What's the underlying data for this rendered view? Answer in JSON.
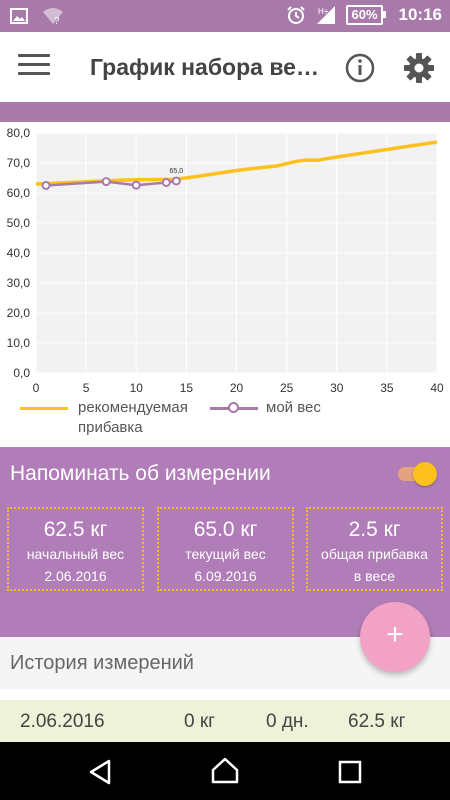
{
  "status_bar": {
    "battery": "60%",
    "time": "10:16",
    "icons": [
      "image-icon",
      "wifi-unknown-icon",
      "alarm-icon",
      "signal-icon",
      "battery-icon"
    ]
  },
  "app_bar": {
    "title": "График набора ве…",
    "icons": [
      "menu-icon",
      "info-icon",
      "settings-icon"
    ]
  },
  "chart_data": {
    "type": "line",
    "xlim": [
      0,
      40
    ],
    "ylim": [
      0,
      80
    ],
    "x_ticks": [
      "0",
      "5",
      "10",
      "15",
      "20",
      "25",
      "30",
      "35",
      "40"
    ],
    "y_ticks": [
      "0,0",
      "10,0",
      "20,0",
      "30,0",
      "40,0",
      "50,0",
      "60,0",
      "70,0",
      "80,0"
    ],
    "grid": true,
    "legend_position": "bottom",
    "series": [
      {
        "name": "рекомендуемая прибавка",
        "color": "#fcc11e",
        "x": [
          0,
          2,
          4,
          6,
          8,
          10,
          12,
          14,
          16,
          18,
          20,
          22,
          24,
          26,
          27,
          28,
          30,
          32,
          34,
          36,
          38,
          40
        ],
        "y": [
          63,
          63.3,
          63.6,
          63.9,
          64.2,
          64.4,
          64.5,
          64.6,
          65.5,
          66.5,
          67.5,
          68.3,
          69,
          70.6,
          71,
          70.9,
          72,
          73,
          74,
          75,
          76,
          77
        ]
      },
      {
        "name": "мой вес",
        "color": "#a77aa9",
        "x": [
          1,
          7,
          10,
          13,
          14
        ],
        "y": [
          62.5,
          63.8,
          62.6,
          63.5,
          64
        ]
      }
    ],
    "annotations": [
      {
        "text": "65,0"
      }
    ]
  },
  "reminder": {
    "label": "Напоминать об измерении",
    "enabled": true
  },
  "stats": [
    {
      "value": "62.5 кг",
      "label1": "начальный вес",
      "label2": "2.06.2016"
    },
    {
      "value": "65.0 кг",
      "label1": "текущий вес",
      "label2": "6.09.2016"
    },
    {
      "value": "2.5 кг",
      "label1": "общая прибавка",
      "label2": "в весе"
    }
  ],
  "history": {
    "title": "История измерений",
    "rows": [
      {
        "date": "2.06.2016",
        "gain": "0 кг",
        "days": "0 дн.",
        "weight": "62.5 кг"
      }
    ]
  },
  "fab": {
    "label": "+"
  },
  "colors": {
    "primary": "#a77aa9",
    "reminder_bg": "#b07db8",
    "accent": "#fcc11e",
    "fab": "#f2a2c5",
    "row_bg": "#eef2d9"
  }
}
